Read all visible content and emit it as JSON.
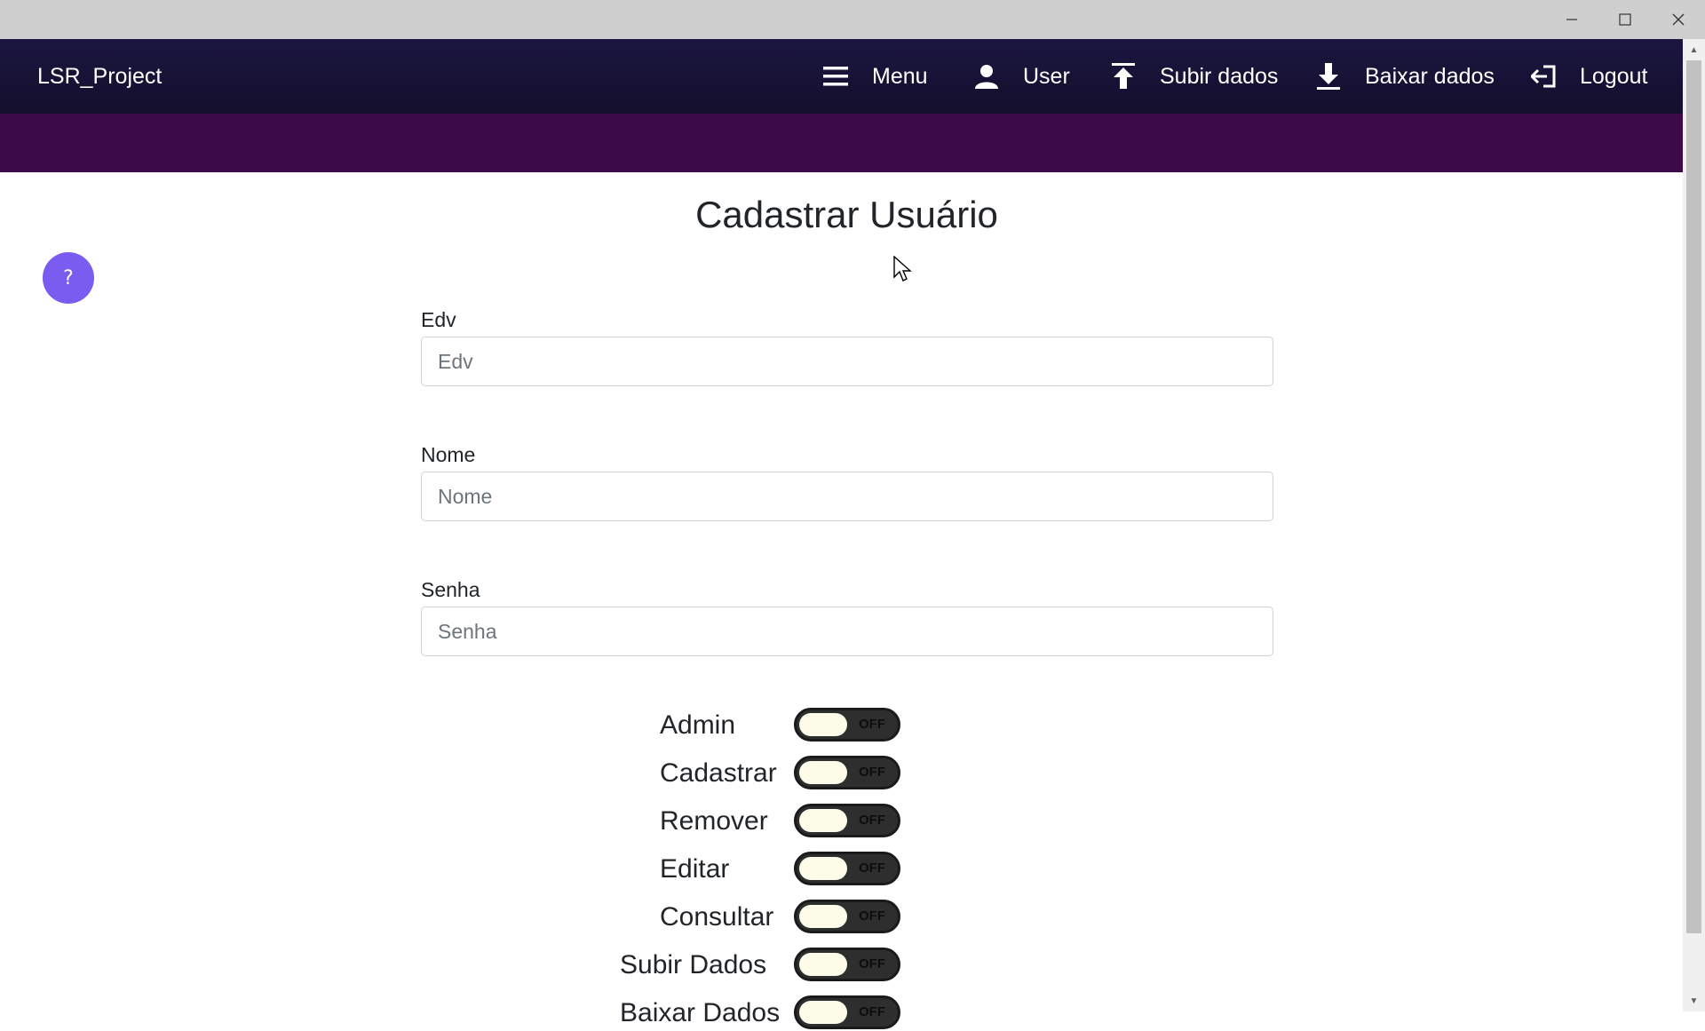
{
  "app": {
    "brand": "LSR_Project"
  },
  "nav": {
    "menu": "Menu",
    "user": "User",
    "upload": "Subir dados",
    "download": "Baixar dados",
    "logout": "Logout"
  },
  "help": {
    "label": "?"
  },
  "form": {
    "title": "Cadastrar Usuário",
    "edv": {
      "label": "Edv",
      "placeholder": "Edv",
      "value": ""
    },
    "nome": {
      "label": "Nome",
      "placeholder": "Nome",
      "value": ""
    },
    "senha": {
      "label": "Senha",
      "placeholder": "Senha",
      "value": ""
    }
  },
  "permissions": [
    {
      "label": "Admin",
      "state": "OFF"
    },
    {
      "label": "Cadastrar",
      "state": "OFF"
    },
    {
      "label": "Remover",
      "state": "OFF"
    },
    {
      "label": "Editar",
      "state": "OFF"
    },
    {
      "label": "Consultar",
      "state": "OFF"
    },
    {
      "label": "Subir Dados",
      "state": "OFF"
    },
    {
      "label": "Baixar Dados",
      "state": "OFF"
    }
  ],
  "colors": {
    "navbar": "#1b1640",
    "subbar": "#3b0a47",
    "help_button": "#7b5cf0",
    "toggle_track": "#2e2e2e",
    "toggle_knob": "#fcfce8"
  }
}
